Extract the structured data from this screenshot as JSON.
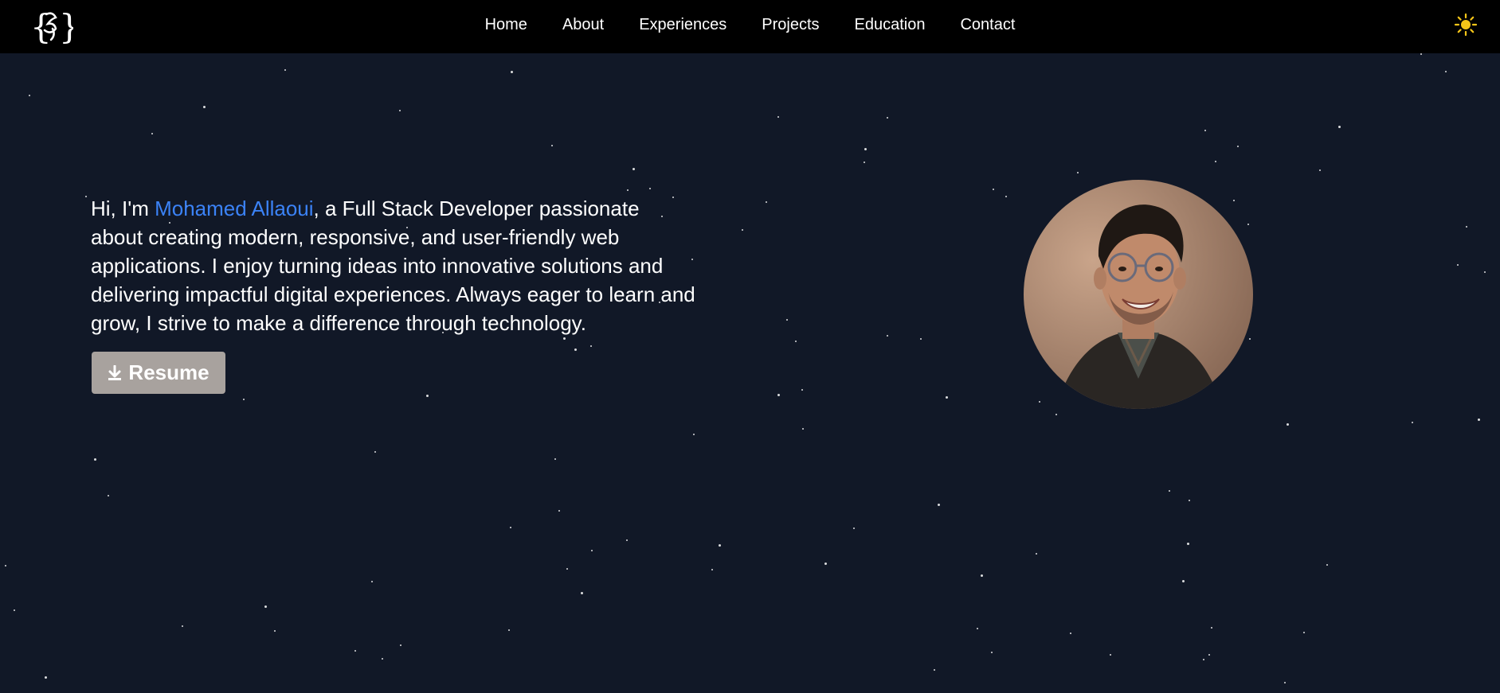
{
  "nav": {
    "logo_icon": "curly-brace-logo-icon",
    "links": [
      {
        "label": "Home"
      },
      {
        "label": "About"
      },
      {
        "label": "Experiences"
      },
      {
        "label": "Projects"
      },
      {
        "label": "Education"
      },
      {
        "label": "Contact"
      }
    ],
    "theme_icon": "sun-icon"
  },
  "hero": {
    "intro_prefix": "Hi, I'm ",
    "name": "Mohamed Allaoui",
    "intro_suffix": ", a Full Stack Developer passionate about creating modern, responsive, and user-friendly web applications. I enjoy turning ideas into innovative solutions and delivering impactful digital experiences. Always eager to learn and grow, I strive to make a difference through technology.",
    "resume_label": "Resume",
    "resume_icon": "download-icon",
    "avatar_icon": "profile-photo"
  },
  "colors": {
    "background": "#111827",
    "navbar": "#000000",
    "accent": "#3b82f6",
    "button": "#a8a29e",
    "sun": "#f5c518"
  }
}
